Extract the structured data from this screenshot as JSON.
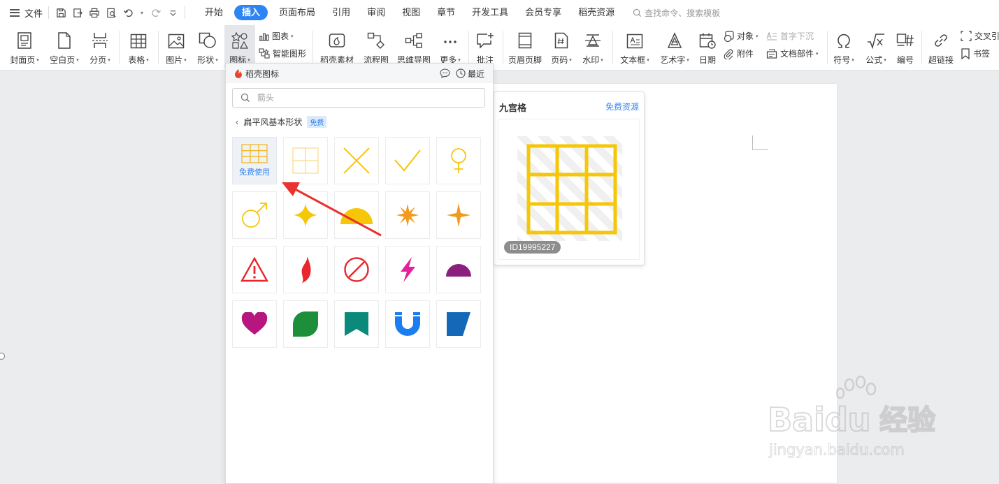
{
  "menubar": {
    "file_label": "文件",
    "tabs": [
      {
        "label": "开始",
        "active": false
      },
      {
        "label": "插入",
        "active": true
      },
      {
        "label": "页面布局",
        "active": false
      },
      {
        "label": "引用",
        "active": false
      },
      {
        "label": "审阅",
        "active": false
      },
      {
        "label": "视图",
        "active": false
      },
      {
        "label": "章节",
        "active": false
      },
      {
        "label": "开发工具",
        "active": false
      },
      {
        "label": "会员专享",
        "active": false
      },
      {
        "label": "稻壳资源",
        "active": false
      }
    ],
    "search_placeholder": "查找命令、搜索模板"
  },
  "ribbon": {
    "cover": "封面页",
    "blank": "空白页",
    "pagebreak": "分页",
    "table": "表格",
    "picture": "图片",
    "shape": "形状",
    "icon": "图标",
    "chart": "图表",
    "smartart": "智能图形",
    "daoke": "稻壳素材",
    "flowchart": "流程图",
    "mindmap": "思维导图",
    "more": "更多",
    "comment": "批注",
    "header_footer": "页眉页脚",
    "page_number": "页码",
    "watermark": "水印",
    "textbox": "文本框",
    "wordart": "艺术字",
    "date": "日期",
    "object": "对象",
    "attachment": "附件",
    "dropcap": "首字下沉",
    "doc_parts": "文档部件",
    "symbol": "符号",
    "formula": "公式",
    "numbering": "编号",
    "hyperlink": "超链接",
    "crossref": "交叉引",
    "bookmark": "书签"
  },
  "icon_panel": {
    "brand": "稻壳图标",
    "recent": "最近",
    "search_placeholder": "箭头",
    "category": "扁平风基本形状",
    "category_badge": "免费",
    "hover_use_label": "免费使用",
    "icons": [
      "grid-3x3-icon",
      "grid-2x2-icon",
      "cross-icon",
      "check-icon",
      "female-symbol-icon",
      "male-symbol-icon",
      "sparkle-star-icon",
      "half-circle-icon",
      "orange-starburst-icon",
      "four-point-star-icon",
      "warning-triangle-icon",
      "flame-icon",
      "prohibited-icon",
      "lightning-icon",
      "purple-semicircle-icon",
      "heart-icon",
      "leaf-icon",
      "bookmark-ribbon-icon",
      "magnet-icon",
      "parallelogram-icon"
    ]
  },
  "preview": {
    "title": "九宫格",
    "resource_link": "免费资源",
    "id_badge": "ID19995227"
  },
  "watermark": {
    "brand": "Baidu",
    "cn": "经验",
    "url": "jingyan.baidu.com"
  },
  "colors": {
    "accent": "#2d84f4",
    "icon_yellow": "#f6c609",
    "icon_orange": "#f29a1e",
    "warn_red": "#e8262d",
    "magenta": "#e61f9d",
    "purple": "#8a1f7e",
    "heart": "#b6167e",
    "green": "#1d8f3a",
    "teal": "#0b8a7b",
    "blue": "#1a7ef0",
    "navy": "#1568b8"
  }
}
